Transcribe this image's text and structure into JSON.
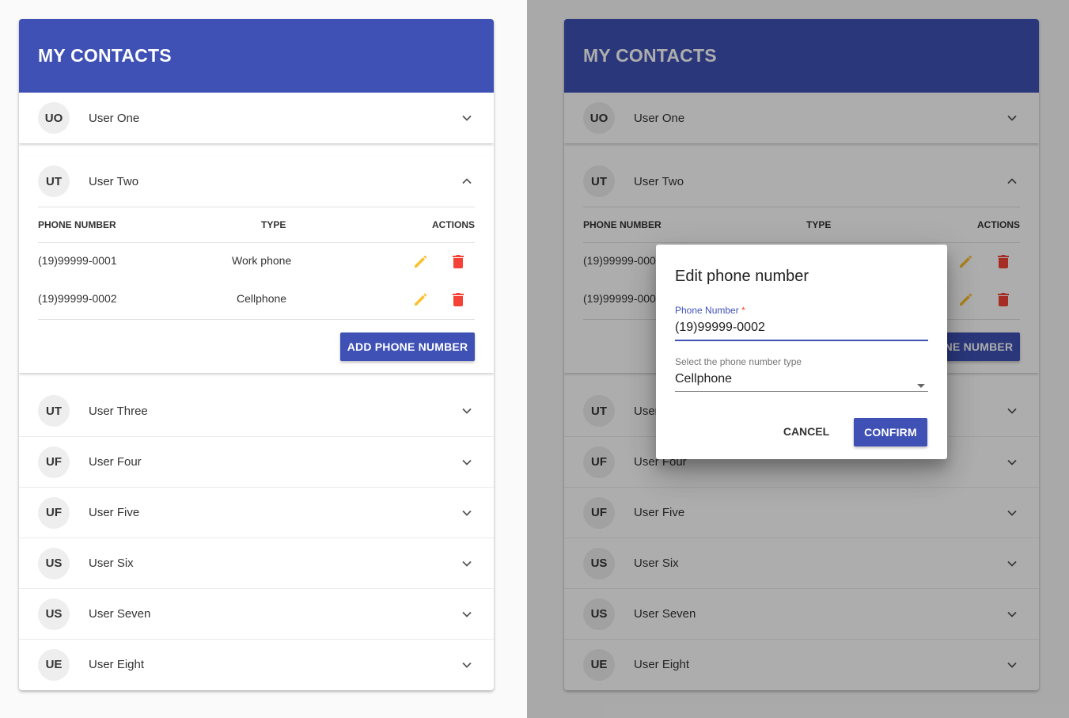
{
  "app": {
    "title": "MY CONTACTS"
  },
  "contacts": [
    {
      "initials": "UO",
      "name": "User One"
    },
    {
      "initials": "UT",
      "name": "User Two"
    },
    {
      "initials": "UT",
      "name": "User Three"
    },
    {
      "initials": "UF",
      "name": "User Four"
    },
    {
      "initials": "UF",
      "name": "User Five"
    },
    {
      "initials": "US",
      "name": "User Six"
    },
    {
      "initials": "US",
      "name": "User Seven"
    },
    {
      "initials": "UE",
      "name": "User Eight"
    }
  ],
  "phone_table": {
    "headers": {
      "number": "PHONE NUMBER",
      "type": "TYPE",
      "actions": "ACTIONS"
    },
    "rows": [
      {
        "number": "(19)99999-0001",
        "type": "Work phone"
      },
      {
        "number": "(19)99999-0002",
        "type": "Cellphone"
      }
    ],
    "add_button": "ADD PHONE NUMBER"
  },
  "dialog": {
    "title": "Edit phone number",
    "phone_label": "Phone Number",
    "required_mark": "*",
    "phone_value": "(19)99999-0002",
    "type_label": "Select the phone number type",
    "type_value": "Cellphone",
    "cancel": "CANCEL",
    "confirm": "CONFIRM"
  },
  "colors": {
    "primary": "#3f51b5",
    "edit_icon": "#fbc02d",
    "delete_icon": "#f44336",
    "required": "#f44336"
  },
  "icons": {
    "expand": "chevron-down-icon",
    "collapse": "chevron-up-icon",
    "edit": "pencil-icon",
    "delete": "trash-icon",
    "select": "caret-down-icon"
  }
}
